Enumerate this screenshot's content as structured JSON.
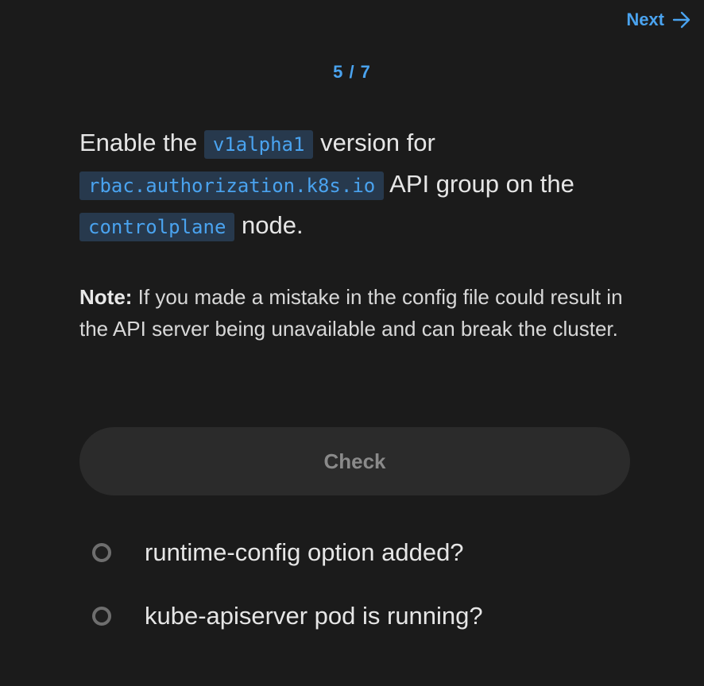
{
  "nav": {
    "next_label": "Next",
    "next_icon": "arrow-right-icon"
  },
  "progress": {
    "current": 5,
    "total": 7,
    "label": "5 / 7"
  },
  "task": {
    "part1": "Enable the ",
    "code1": "v1alpha1",
    "part2": " version for ",
    "code2": "rbac.authorization.k8s.io",
    "part3": " API group on the ",
    "code3": "controlplane",
    "part4": " node."
  },
  "note": {
    "label": "Note:",
    "text": " If you made a mistake in the config file could result in the API server being unavailable and can break the cluster."
  },
  "check_button": {
    "label": "Check"
  },
  "checks": [
    {
      "label": "runtime-config option added?",
      "status": "pending"
    },
    {
      "label": "kube-apiserver pod is running?",
      "status": "pending"
    }
  ],
  "colors": {
    "background": "#1b1b1b",
    "accent": "#4aa3ef",
    "code_bg": "#27394d",
    "button_bg": "#2b2b2b",
    "button_text": "#8a8a8a",
    "ring": "#6e6e6e"
  }
}
